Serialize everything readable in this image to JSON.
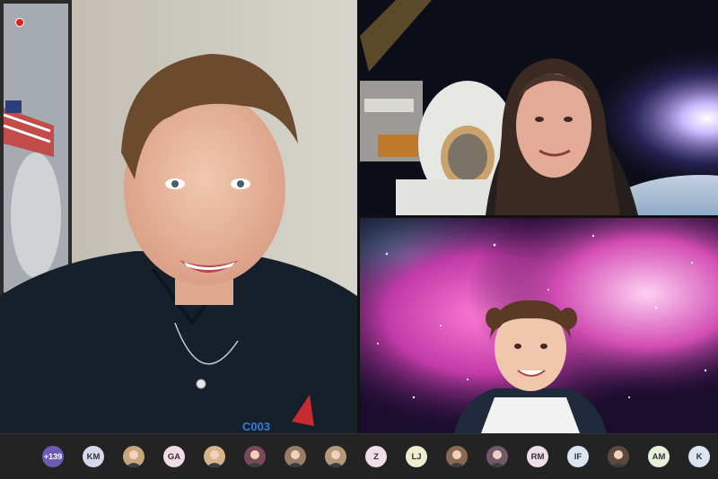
{
  "meeting": {
    "overflow_count": "+139"
  },
  "participants": [
    {
      "kind": "initials",
      "initials": "KM",
      "color": "#d7d7ee"
    },
    {
      "kind": "photo",
      "color": "#c9a77d"
    },
    {
      "kind": "initials",
      "initials": "GA",
      "color": "#f0dbe6"
    },
    {
      "kind": "photo",
      "color": "#d6b38a"
    },
    {
      "kind": "photo",
      "color": "#7a4a5a"
    },
    {
      "kind": "photo",
      "color": "#9a7d66"
    },
    {
      "kind": "photo",
      "color": "#b59a7a"
    },
    {
      "kind": "initials",
      "initials": "Z",
      "color": "#f1dde8"
    },
    {
      "kind": "initials",
      "initials": "LJ",
      "color": "#f0eccf"
    },
    {
      "kind": "photo",
      "color": "#8c6a52"
    },
    {
      "kind": "photo",
      "color": "#6f5a6a"
    },
    {
      "kind": "initials",
      "initials": "RM",
      "color": "#f1dde8"
    },
    {
      "kind": "initials",
      "initials": "IF",
      "color": "#dbe4f1"
    },
    {
      "kind": "photo",
      "color": "#5d4a3e"
    },
    {
      "kind": "initials",
      "initials": "AM",
      "color": "#e6f0d8"
    },
    {
      "kind": "initials",
      "initials": "K",
      "color": "#dbe4f1"
    }
  ],
  "colors": {
    "recording": "#e02020",
    "roster_bg": "#232323",
    "count_badge": "#6b5bb5"
  }
}
